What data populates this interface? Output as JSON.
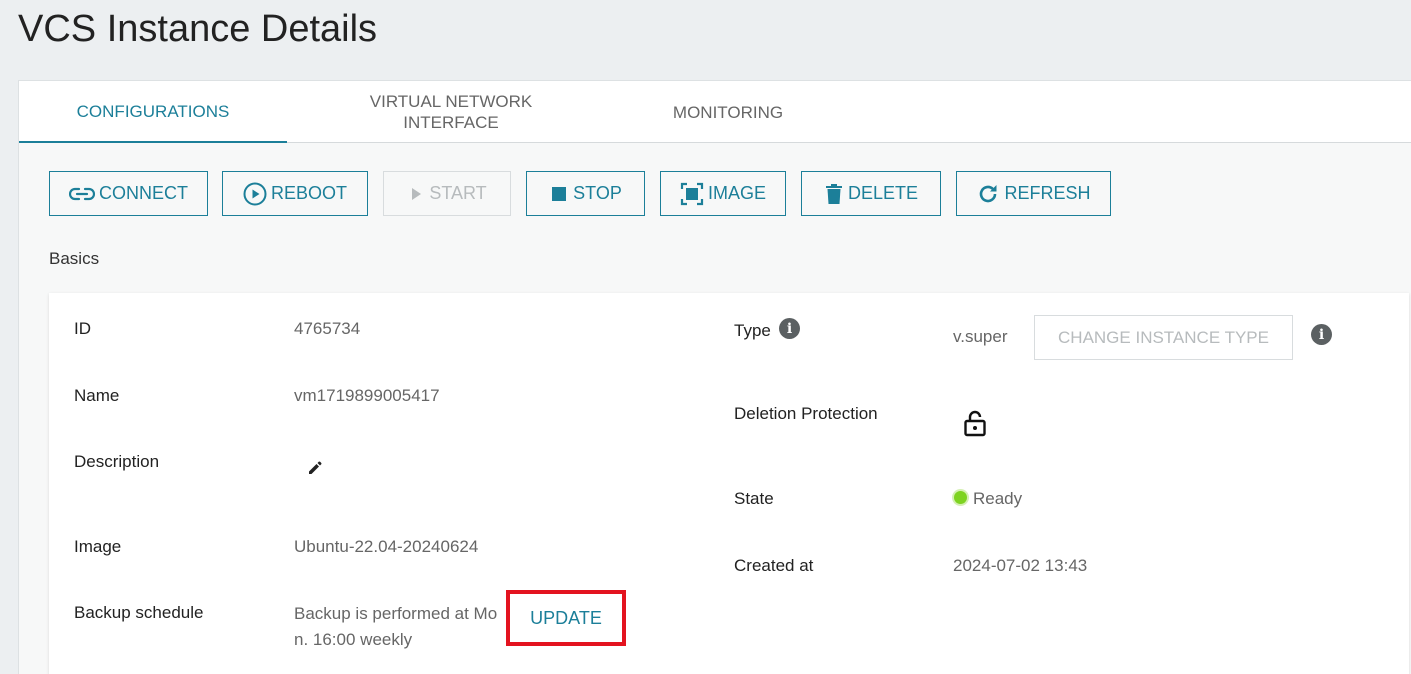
{
  "page": {
    "title": "VCS Instance Details"
  },
  "tabs": [
    {
      "label": "CONFIGURATIONS"
    },
    {
      "label": "VIRTUAL NETWORK INTERFACE"
    },
    {
      "label": "MONITORING"
    }
  ],
  "toolbar": {
    "connect": "CONNECT",
    "reboot": "REBOOT",
    "start": "START",
    "stop": "STOP",
    "image": "IMAGE",
    "delete": "DELETE",
    "refresh": "REFRESH"
  },
  "section": {
    "label": "Basics"
  },
  "details": {
    "id_label": "ID",
    "id_value": "4765734",
    "name_label": "Name",
    "name_value": "vm1719899005417",
    "description_label": "Description",
    "image_label": "Image",
    "image_value": "Ubuntu-22.04-20240624",
    "backup_label": "Backup schedule",
    "backup_value": "Backup is performed at Mon. 16:00 weekly",
    "update_label": "UPDATE",
    "type_label": "Type",
    "type_value": "v.super",
    "change_type_label": "CHANGE INSTANCE TYPE",
    "deletion_label": "Deletion Protection",
    "state_label": "State",
    "state_value": "Ready",
    "created_label": "Created at",
    "created_value": "2024-07-02 13:43"
  },
  "colors": {
    "accent": "#1c7f99",
    "ready": "#7ed321",
    "highlight": "#e3131f"
  },
  "icons": [
    "link-icon",
    "play-circle-icon",
    "play-icon",
    "stop-icon",
    "image-frame-icon",
    "trash-icon",
    "refresh-icon",
    "info-icon",
    "pencil-icon",
    "unlock-icon"
  ]
}
